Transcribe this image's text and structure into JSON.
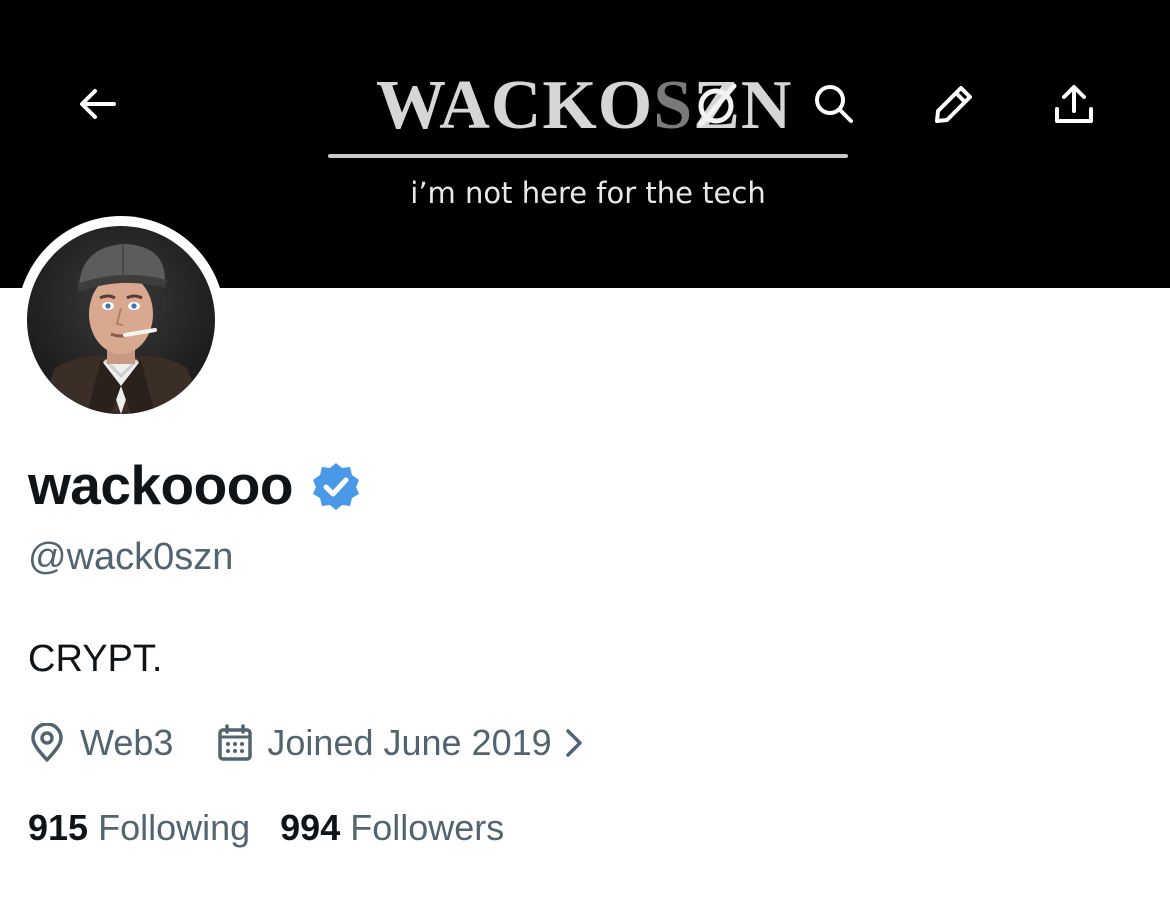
{
  "banner": {
    "title_main": "WACKO",
    "title_mid": "S",
    "title_end": "ZN",
    "tagline": "i’m not here for the tech"
  },
  "nav": {
    "back_icon": "arrow-left-icon",
    "search_icon": "search-icon",
    "edit_icon": "pencil-icon",
    "share_icon": "share-upload-icon"
  },
  "profile": {
    "display_name": "wackoooo",
    "verified": true,
    "handle": "@wack0szn",
    "bio": "CRYPT.",
    "location": "Web3",
    "joined": "Joined June 2019",
    "following_count": "915",
    "following_label": "Following",
    "followers_count": "994",
    "followers_label": "Followers"
  },
  "colors": {
    "verified_blue": "#4a99e9",
    "secondary_text": "#536471",
    "primary_text": "#0f1419",
    "banner_bg": "#000000"
  }
}
